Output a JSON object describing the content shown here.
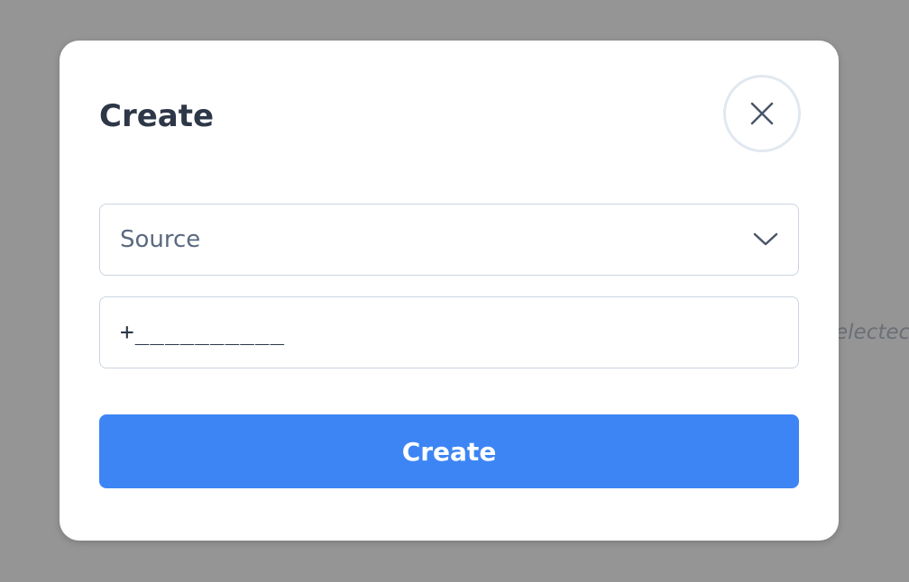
{
  "background": {
    "partial_text": "electec"
  },
  "modal": {
    "title": "Create",
    "close_icon": "close-icon",
    "source_select": {
      "placeholder": "Source",
      "icon": "chevron-down-icon"
    },
    "phone_input": {
      "value": "+__________"
    },
    "submit_label": "Create"
  },
  "colors": {
    "overlay": "#959595",
    "modal_bg": "#ffffff",
    "title": "#2d3748",
    "border": "#cbd5e0",
    "primary": "#3d85f4"
  }
}
